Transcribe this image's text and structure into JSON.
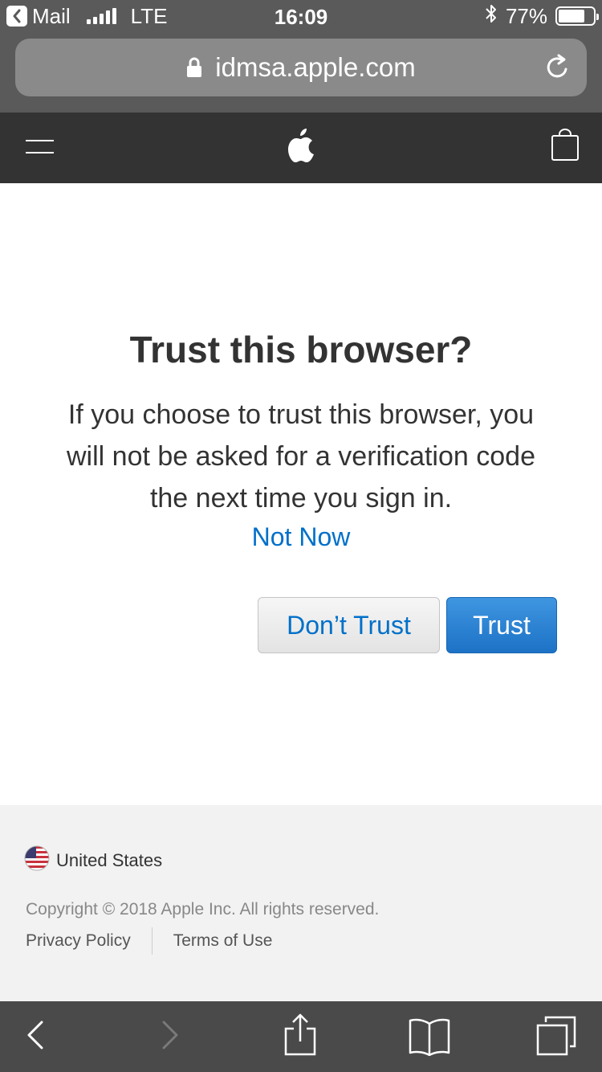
{
  "status_bar": {
    "back_app_label": "Mail",
    "carrier": "LTE",
    "time": "16:09",
    "bluetooth_icon": "bluetooth-icon",
    "battery_percent_label": "77%",
    "battery_level": 0.77
  },
  "url_bar": {
    "host": "idmsa.apple.com",
    "lock_icon": "lock-icon",
    "reload_icon": "reload-icon"
  },
  "apple_nav": {
    "menu_icon": "menu-icon",
    "logo_icon": "apple-logo-icon",
    "bag_icon": "shopping-bag-icon",
    "background": "#333333"
  },
  "dialog": {
    "title": "Trust this browser?",
    "description": "If you choose to trust this browser, you will not be asked for a verification code the next time you sign in.",
    "not_now_label": "Not Now",
    "dont_trust_label": "Don’t Trust",
    "trust_label": "Trust",
    "accent_color": "#0070c9"
  },
  "footer": {
    "country_label": "United States",
    "flag_icon": "us-flag-icon",
    "copyright": "Copyright © 2018 Apple Inc. All rights reserved.",
    "links": [
      "Privacy Policy",
      "Terms of Use"
    ]
  },
  "toolbar": {
    "icons": [
      "back-icon",
      "forward-icon",
      "share-icon",
      "bookmarks-icon",
      "tabs-icon"
    ]
  }
}
